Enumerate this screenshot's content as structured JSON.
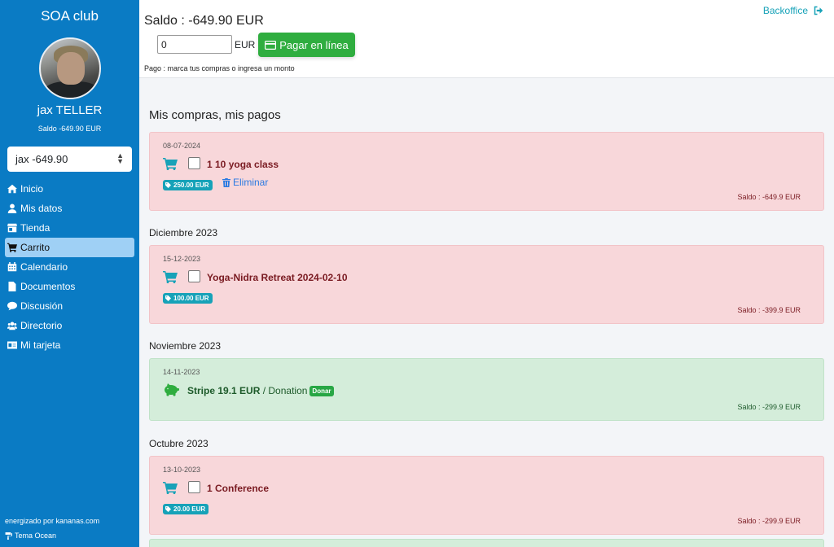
{
  "sidebar": {
    "brand": "SOA club",
    "user_name": "jax TELLER",
    "user_saldo": "Saldo  -649.90 EUR",
    "account_select": "jax -649.90",
    "items": [
      {
        "label": "Inicio",
        "icon": "home-icon"
      },
      {
        "label": "Mis datos",
        "icon": "user-icon"
      },
      {
        "label": "Tienda",
        "icon": "store-icon"
      },
      {
        "label": "Carrito",
        "icon": "cart-icon",
        "active": true
      },
      {
        "label": "Calendario",
        "icon": "calendar-icon"
      },
      {
        "label": "Documentos",
        "icon": "file-icon"
      },
      {
        "label": "Discusión",
        "icon": "chat-icon"
      },
      {
        "label": "Directorio",
        "icon": "users-icon"
      },
      {
        "label": "Mi tarjeta",
        "icon": "id-card-icon"
      }
    ],
    "powered_by": "energizado por kananas.com",
    "theme": "Tema Ocean"
  },
  "header": {
    "saldo_title": "Saldo : -649.90 EUR",
    "amount_value": "0",
    "currency": "EUR",
    "pay_button": "Pagar en línea",
    "pay_hint": "Pago : marca tus compras o ingresa un monto",
    "backoffice": "Backoffice"
  },
  "main": {
    "title": "Mis compras, mis pagos",
    "entries": [
      {
        "date": "08-07-2024",
        "title": "1 10 yoga class",
        "price": "250.00 EUR",
        "delete": "Eliminar",
        "saldo": "Saldo : -649.9 EUR"
      },
      {
        "month": "Diciembre 2023",
        "date": "15-12-2023",
        "title": "Yoga-Nidra Retreat 2024-02-10",
        "price": "100.00 EUR",
        "saldo": "Saldo : -399.9 EUR"
      },
      {
        "month": "Noviembre 2023",
        "date": "14-11-2023",
        "stripe": "Stripe 19.1 EUR",
        "kind": " / Donation",
        "badge": "Donar",
        "saldo": "Saldo : -299.9 EUR"
      },
      {
        "month": "Octubre 2023",
        "date": "13-10-2023",
        "title": "1 Conference",
        "price": "20.00 EUR",
        "saldo": "Saldo : -299.9 EUR"
      }
    ]
  },
  "colors": {
    "sidebar": "#0a7bc4",
    "active_nav": "#9fd0f5",
    "pay_button": "#2fad3f",
    "accent": "#17a2b8",
    "debit_card": "#f8d7da",
    "credit_card": "#d4edda"
  }
}
